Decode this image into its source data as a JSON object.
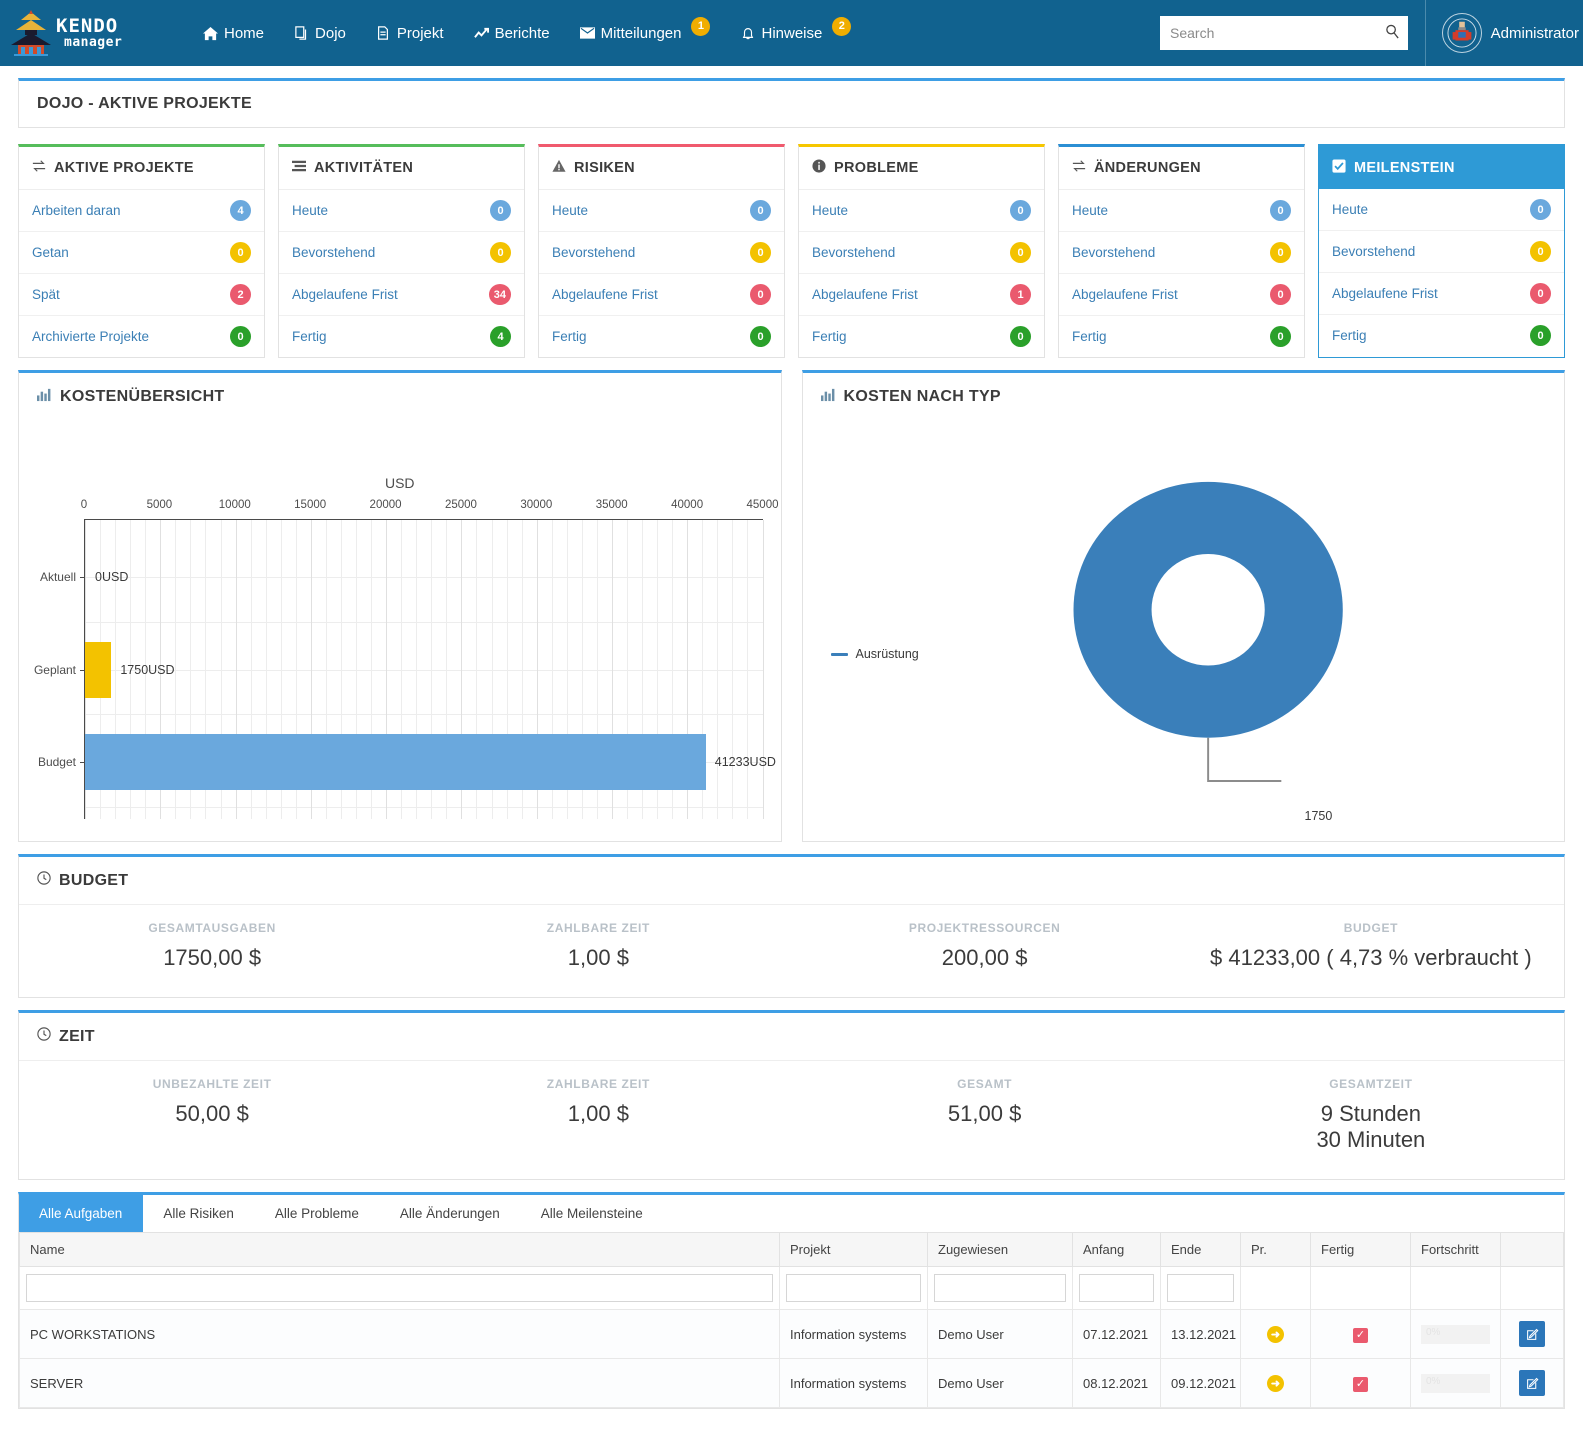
{
  "header": {
    "brand": {
      "line1": "KENDO",
      "line2": "manager",
      "logo_icon": "pagoda-logo-icon"
    },
    "nav": [
      {
        "label": "Home",
        "icon": "home-icon",
        "badge": null
      },
      {
        "label": "Dojo",
        "icon": "copy-icon",
        "badge": null
      },
      {
        "label": "Projekt",
        "icon": "document-icon",
        "badge": null
      },
      {
        "label": "Berichte",
        "icon": "chart-line-icon",
        "badge": null
      },
      {
        "label": "Mitteilungen",
        "icon": "envelope-icon",
        "badge": "1"
      },
      {
        "label": "Hinweise",
        "icon": "bell-icon",
        "badge": "2"
      }
    ],
    "search": {
      "placeholder": "Search",
      "value": "",
      "icon": "search-icon"
    },
    "user": {
      "name": "Administrator",
      "avatar_icon": "user-avatar-icon"
    },
    "bg_color": "#11628f",
    "badge_color": "#f0ad00"
  },
  "page_title": "DOJO - AKTIVE PROJEKTE",
  "cards": [
    {
      "title": "AKTIVE PROJEKTE",
      "icon": "exchange-icon",
      "accent": "#56bd5b",
      "active": false,
      "rows": [
        {
          "label": "Arbeiten daran",
          "value": "4",
          "color": "blue"
        },
        {
          "label": "Getan",
          "value": "0",
          "color": "yellow"
        },
        {
          "label": "Spät",
          "value": "2",
          "color": "red"
        },
        {
          "label": "Archivierte Projekte",
          "value": "0",
          "color": "green"
        }
      ]
    },
    {
      "title": "AKTIVITÄTEN",
      "icon": "list-icon",
      "accent": "#56bd5b",
      "active": false,
      "rows": [
        {
          "label": "Heute",
          "value": "0",
          "color": "blue"
        },
        {
          "label": "Bevorstehend",
          "value": "0",
          "color": "yellow"
        },
        {
          "label": "Abgelaufene Frist",
          "value": "34",
          "color": "red"
        },
        {
          "label": "Fertig",
          "value": "4",
          "color": "green"
        }
      ]
    },
    {
      "title": "RISIKEN",
      "icon": "warning-icon",
      "accent": "#f05a6e",
      "active": false,
      "rows": [
        {
          "label": "Heute",
          "value": "0",
          "color": "blue"
        },
        {
          "label": "Bevorstehend",
          "value": "0",
          "color": "yellow"
        },
        {
          "label": "Abgelaufene Frist",
          "value": "0",
          "color": "red"
        },
        {
          "label": "Fertig",
          "value": "0",
          "color": "green"
        }
      ]
    },
    {
      "title": "PROBLEME",
      "icon": "info-icon",
      "accent": "#f6c700",
      "active": false,
      "rows": [
        {
          "label": "Heute",
          "value": "0",
          "color": "blue"
        },
        {
          "label": "Bevorstehend",
          "value": "0",
          "color": "yellow"
        },
        {
          "label": "Abgelaufene Frist",
          "value": "1",
          "color": "red"
        },
        {
          "label": "Fertig",
          "value": "0",
          "color": "green"
        }
      ]
    },
    {
      "title": "ÄNDERUNGEN",
      "icon": "exchange-icon",
      "accent": "#2b8fd4",
      "active": false,
      "rows": [
        {
          "label": "Heute",
          "value": "0",
          "color": "blue"
        },
        {
          "label": "Bevorstehend",
          "value": "0",
          "color": "yellow"
        },
        {
          "label": "Abgelaufene Frist",
          "value": "0",
          "color": "red"
        },
        {
          "label": "Fertig",
          "value": "0",
          "color": "green"
        }
      ]
    },
    {
      "title": "MEILENSTEIN",
      "icon": "checkbox-icon",
      "accent": "#2e9ad6",
      "active": true,
      "rows": [
        {
          "label": "Heute",
          "value": "0",
          "color": "blue"
        },
        {
          "label": "Bevorstehend",
          "value": "0",
          "color": "yellow"
        },
        {
          "label": "Abgelaufene Frist",
          "value": "0",
          "color": "red"
        },
        {
          "label": "Fertig",
          "value": "0",
          "color": "green"
        }
      ]
    }
  ],
  "chart_data": [
    {
      "type": "bar",
      "orientation": "horizontal",
      "panel_title": "KOSTENÜBERSICHT",
      "panel_icon": "bar-chart-icon",
      "title": "",
      "xlabel": "USD",
      "ylabel": "",
      "categories": [
        "Aktuell",
        "Geplant",
        "Budget"
      ],
      "values": [
        0,
        1750,
        41233
      ],
      "data_labels": [
        "0USD",
        "1750USD",
        "41233USD"
      ],
      "bar_colors": [
        "#6aa8dd",
        "#f3c200",
        "#6aa8dd"
      ],
      "xlim": [
        0,
        45000
      ],
      "xticks": [
        0,
        5000,
        10000,
        15000,
        20000,
        25000,
        30000,
        35000,
        40000,
        45000
      ],
      "xtick_labels": [
        "0",
        "5000",
        "10000",
        "15000",
        "20000",
        "25000",
        "30000",
        "35000",
        "40000",
        "45000"
      ],
      "grid": true,
      "legend": false
    },
    {
      "type": "pie",
      "variant": "donut",
      "panel_title": "KOSTEN NACH TYP",
      "panel_icon": "bar-chart-icon",
      "title": "",
      "labels": [
        "Ausrüstung"
      ],
      "values": [
        1750
      ],
      "data_labels": [
        "1750"
      ],
      "colors": [
        "#3a7fba"
      ],
      "legend": true,
      "legend_position": "left"
    }
  ],
  "budget": {
    "title": "BUDGET",
    "icon": "clock-icon",
    "items": [
      {
        "label": "GESAMTAUSGABEN",
        "value": "1750,00 $"
      },
      {
        "label": "ZAHLBARE ZEIT",
        "value": "1,00 $"
      },
      {
        "label": "PROJEKTRESSOURCEN",
        "value": "200,00 $"
      },
      {
        "label": "BUDGET",
        "value": "$ 41233,00 ( 4,73 % verbraucht )"
      }
    ]
  },
  "zeit": {
    "title": "ZEIT",
    "icon": "clock-icon",
    "items": [
      {
        "label": "UNBEZAHLTE ZEIT",
        "value": "50,00 $"
      },
      {
        "label": "ZAHLBARE ZEIT",
        "value": "1,00 $"
      },
      {
        "label": "GESAMT",
        "value": "51,00 $"
      },
      {
        "label": "GESAMTZEIT",
        "value": "9 Stunden",
        "value2": "30 Minuten"
      }
    ]
  },
  "tabs": [
    {
      "label": "Alle Aufgaben",
      "active": true
    },
    {
      "label": "Alle Risiken",
      "active": false
    },
    {
      "label": "Alle Probleme",
      "active": false
    },
    {
      "label": "Alle Änderungen",
      "active": false
    },
    {
      "label": "Alle Meilensteine",
      "active": false
    }
  ],
  "table": {
    "columns": [
      "Name",
      "Projekt",
      "Zugewiesen",
      "Anfang",
      "Ende",
      "Pr.",
      "Fertig",
      "Fortschritt",
      ""
    ],
    "filters": [
      "",
      "",
      "",
      "",
      ""
    ],
    "rows": [
      {
        "name": "PC WORKSTATIONS",
        "projekt": "Information systems",
        "zugewiesen": "Demo User",
        "anfang": "07.12.2021",
        "ende": "13.12.2021",
        "pr_icon": "priority-arrow-icon",
        "fertig_icon": "checked-icon",
        "fortschritt": "0%",
        "edit_icon": "edit-icon"
      },
      {
        "name": "SERVER",
        "projekt": "Information systems",
        "zugewiesen": "Demo User",
        "anfang": "08.12.2021",
        "ende": "09.12.2021",
        "pr_icon": "priority-arrow-icon",
        "fertig_icon": "checked-icon",
        "fortschritt": "0%",
        "edit_icon": "edit-icon"
      }
    ]
  }
}
